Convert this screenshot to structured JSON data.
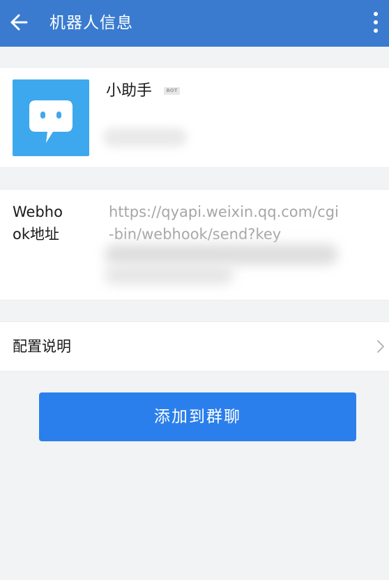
{
  "header": {
    "title": "机器人信息",
    "back_icon": "arrow-left-icon",
    "more_icon": "more-vertical-icon"
  },
  "profile": {
    "name": "小助手",
    "badge": "BOT",
    "avatar_icon": "chat-bubble-icon"
  },
  "webhook": {
    "label": "Webhook地址",
    "url_visible": "https://qyapi.weixin.qq.com/cgi-bin/webhook/send?key"
  },
  "config": {
    "label": "配置说明",
    "chevron_icon": "chevron-right-icon"
  },
  "actions": {
    "add_to_group_label": "添加到群聊"
  },
  "colors": {
    "header_bg": "#3a7bd0",
    "avatar_bg": "#3ea8ee",
    "button_bg": "#2b7fec",
    "page_bg": "#f2f3f5"
  }
}
